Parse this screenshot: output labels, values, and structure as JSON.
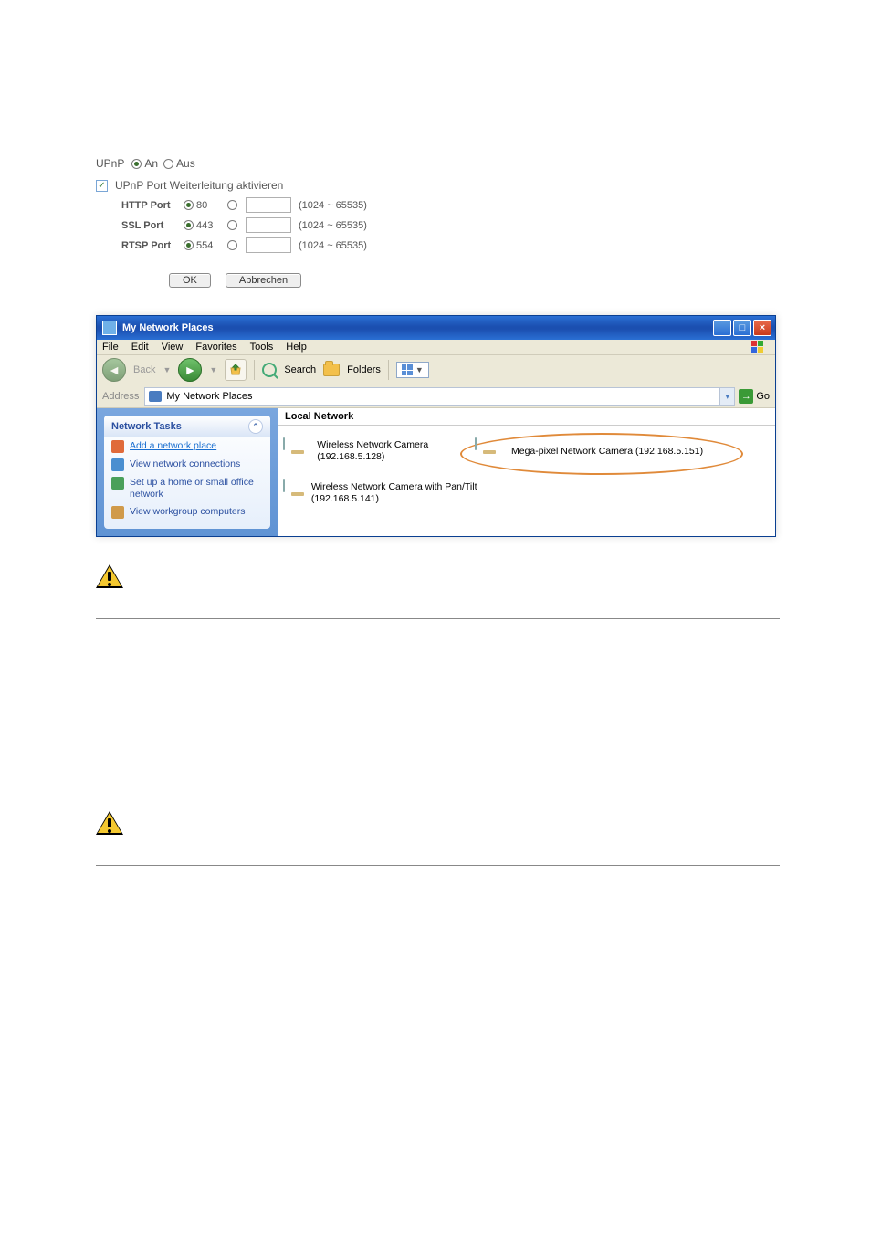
{
  "upnp": {
    "label": "UPnP",
    "on_label": "An",
    "off_label": "Aus",
    "selected": "on",
    "forward_checked": true,
    "forward_label": "UPnP Port Weiterleitung aktivieren",
    "ports": [
      {
        "name": "HTTP Port",
        "default": "80",
        "range": "(1024 ~ 65535)"
      },
      {
        "name": "SSL Port",
        "default": "443",
        "range": "(1024 ~ 65535)"
      },
      {
        "name": "RTSP Port",
        "default": "554",
        "range": "(1024 ~ 65535)"
      }
    ],
    "ok": "OK",
    "cancel": "Abbrechen"
  },
  "window": {
    "title": "My Network Places",
    "menus": [
      "File",
      "Edit",
      "View",
      "Favorites",
      "Tools",
      "Help"
    ],
    "back_label": "Back",
    "search_label": "Search",
    "folders_label": "Folders",
    "address_label": "Address",
    "address_value": "My Network Places",
    "go_label": "Go",
    "tasks_title": "Network Tasks",
    "tasks": [
      "Add a network place",
      "View network connections",
      "Set up a home or small office network",
      "View workgroup computers"
    ],
    "local_header": "Local Network",
    "items": [
      {
        "label": "Wireless Network Camera (192.168.5.128)"
      },
      {
        "label": "Mega-pixel Network Camera (192.168.5.151)"
      },
      {
        "label": "Wireless Network Camera with Pan/Tilt (192.168.5.141)"
      }
    ]
  }
}
